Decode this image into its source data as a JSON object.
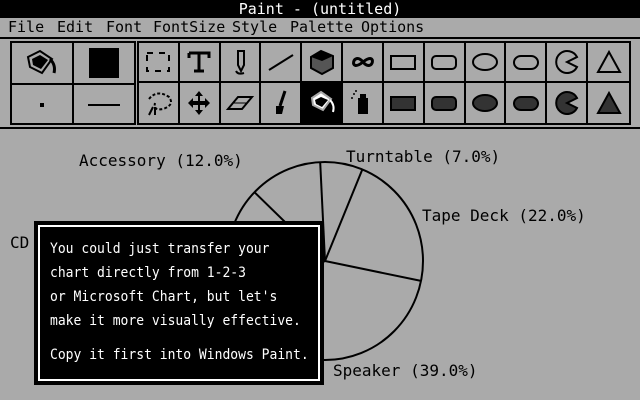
{
  "window": {
    "title": "Paint - (untitled)"
  },
  "menubar": {
    "items": [
      "File",
      "Edit",
      "Font",
      "FontSize",
      "Style",
      "Palette",
      "Options"
    ]
  },
  "toolbox": {
    "left_panel": [
      "paint-bucket-icon",
      "foreground-color-swatch",
      "brush-dot-icon",
      "line-width-icon"
    ],
    "tools_row1": [
      "selection-rect-icon",
      "text-icon",
      "paintbrush-icon",
      "line-icon",
      "cube-icon",
      "curve-icon",
      "rectangle-icon",
      "rounded-rectangle-icon",
      "ellipse-icon",
      "oval-icon",
      "pie-icon",
      "triangle-icon"
    ],
    "tools_row2": [
      "lasso-icon",
      "move-icon",
      "eraser-icon",
      "brush-icon",
      "fill-icon",
      "spray-icon",
      "filled-rectangle-icon",
      "filled-rounded-rectangle-icon",
      "filled-ellipse-icon",
      "filled-oval-icon",
      "filled-pie-icon",
      "filled-triangle-icon"
    ],
    "selected_tool": "fill-icon"
  },
  "chart_data": {
    "type": "pie",
    "categories": [
      "Accessory",
      "Turntable",
      "Tape Deck",
      "Speaker",
      "CD"
    ],
    "labels": [
      "Accessory (12.0%)",
      "Turntable (7.0%)",
      "Tape Deck (22.0%)",
      "Speaker (39.0%)",
      "CD"
    ],
    "values": [
      12.0,
      7.0,
      22.0,
      39.0,
      20.0
    ]
  },
  "message": {
    "lines": [
      "You could just transfer your",
      "chart directly from 1-2-3",
      "or Microsoft Chart, but let's",
      "make it more visually effective.",
      "Copy it first into Windows Paint."
    ]
  },
  "colors": {
    "background": "#aaaaaa",
    "foreground": "#000000",
    "highlight": "#ffffff"
  }
}
